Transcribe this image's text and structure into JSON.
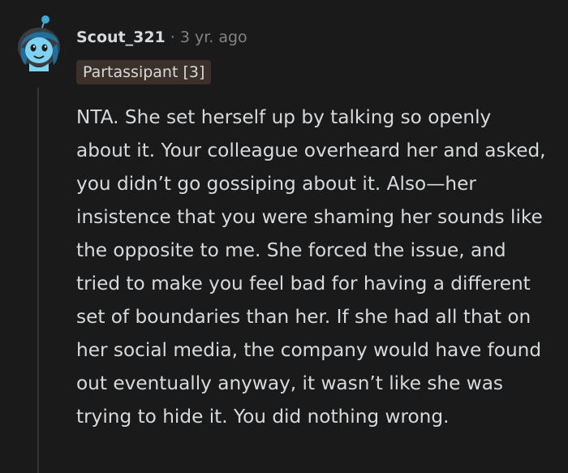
{
  "comment": {
    "author": "Scout_321",
    "separator": "·",
    "timestamp": "3 yr. ago",
    "flair": "Partassipant [3]",
    "avatar_icon": "snoo-avatar-icon",
    "body": "NTA. She set herself up by talking so openly about it. Your colleague overheard her and asked, you didn’t go gossiping about it. Also—her insistence that you were shaming her sounds like the opposite to me. She forced the issue, and tried to make you feel bad for having a different set of boundaries than her. If she had all that on her social media, the company would have found out eventually anyway, it wasn’t like she was trying to hide it. You did nothing wrong."
  },
  "colors": {
    "background": "#1a1a1b",
    "text": "#d7dadc",
    "meta_text": "#818384",
    "flair_bg": "#3b302a",
    "thread_line": "#343536",
    "avatar_accent": "#3fa9d6"
  }
}
